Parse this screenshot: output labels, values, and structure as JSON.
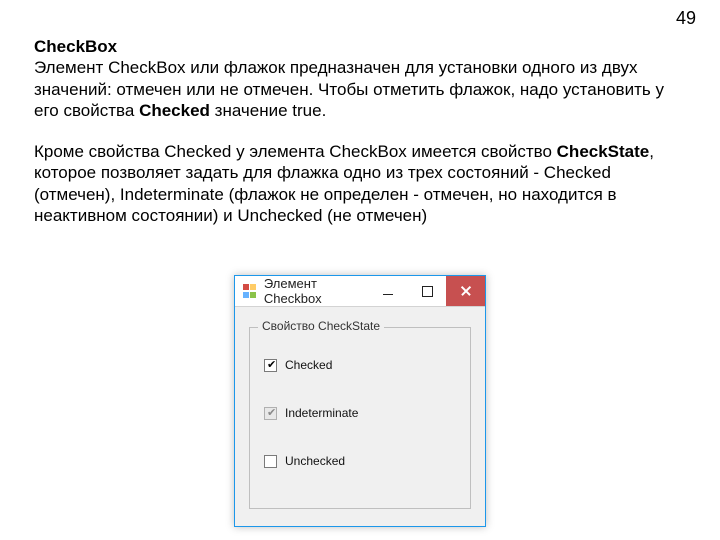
{
  "page_number": "49",
  "heading": "CheckBox",
  "para1_a": "Элемент CheckBox или флажок предназначен для установки одного из двух значений: отмечен или не отмечен. Чтобы отметить флажок, надо установить у его свойства ",
  "para1_bold1": "Checked",
  "para1_b": " значение true.",
  "para2_a": "Кроме свойства Checked у элемента CheckBox имеется свойство ",
  "para2_bold1": "CheckState",
  "para2_b": ", которое позволяет задать для флажка одно из трех состояний - Checked (отмечен), Indeterminate (флажок не определен - отмечен, но находится в неактивном состоянии) и Unchecked (не отмечен)",
  "window": {
    "title": "Элемент Checkbox",
    "group_label": "Свойство CheckState",
    "items": {
      "checked": {
        "label": "Checked"
      },
      "indeterminate": {
        "label": "Indeterminate"
      },
      "unchecked": {
        "label": "Unchecked"
      }
    }
  }
}
